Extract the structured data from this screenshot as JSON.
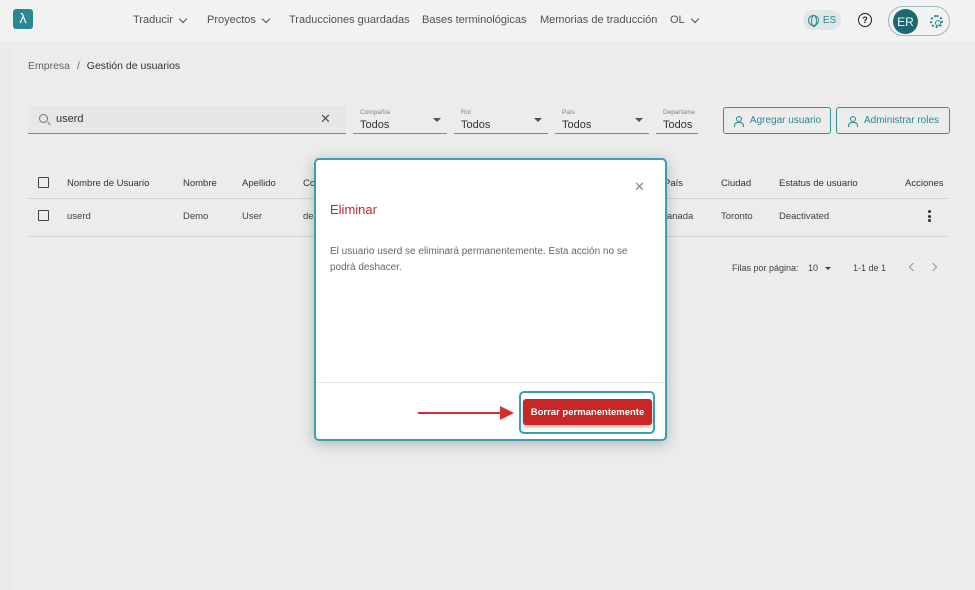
{
  "header": {
    "logo_glyph": "λ",
    "nav": [
      {
        "label": "Traducir",
        "dropdown": true
      },
      {
        "label": "Proyectos",
        "dropdown": true
      },
      {
        "label": "Traducciones guardadas",
        "dropdown": false
      },
      {
        "label": "Bases terminológicas",
        "dropdown": false
      },
      {
        "label": "Memorias de traducción",
        "dropdown": false
      },
      {
        "label": "OL",
        "dropdown": true
      }
    ],
    "language": "ES",
    "help_glyph": "?",
    "avatar_initials": "ER"
  },
  "breadcrumb": {
    "parent": "Empresa",
    "separator": "/",
    "current": "Gestión de usuarios"
  },
  "search": {
    "value": "userd",
    "clear_glyph": "✕"
  },
  "filters": [
    {
      "label": "Compañía",
      "value": "Todos"
    },
    {
      "label": "Rol",
      "value": "Todos"
    },
    {
      "label": "País",
      "value": "Todos"
    },
    {
      "label": "Departame",
      "value": "Todos"
    }
  ],
  "actions": {
    "add_user": "Agregar usuario",
    "manage_roles": "Administrar roles"
  },
  "table": {
    "headers": {
      "username": "Nombre de Usuario",
      "first_name": "Nombre",
      "last_name": "Apellido",
      "company_partial": "Co",
      "country_partial": "País",
      "city": "Ciudad",
      "status": "Estatus de usuario",
      "actions": "Acciones"
    },
    "rows": [
      {
        "username": "userd",
        "first_name": "Demo",
        "last_name": "User",
        "company_partial": "de",
        "country_partial": "Canada",
        "city": "Toronto",
        "status": "Deactivated"
      }
    ]
  },
  "pagination": {
    "rows_per_page_label": "Filas por página:",
    "rows_per_page": "10",
    "range": "1-1 de 1"
  },
  "modal": {
    "close_glyph": "✕",
    "title": "Eliminar",
    "message": "El usuario userd se eliminará permanentemente. Esta acción no se podrá deshacer.",
    "confirm_label": "Borrar permanentemente"
  },
  "colors": {
    "brand": "#2b8d99",
    "danger": "#c62828",
    "annotation": "#d32f2f"
  }
}
